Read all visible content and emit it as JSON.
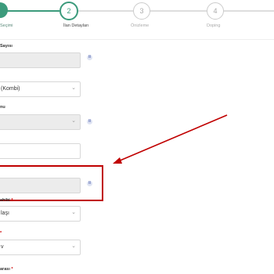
{
  "stepper": {
    "steps": [
      {
        "number": "",
        "label": "Seçimi",
        "state": "done"
      },
      {
        "number": "2",
        "label": "İlan Detayları",
        "state": "active"
      },
      {
        "number": "3",
        "label": "Önizleme",
        "state": "todo"
      },
      {
        "number": "4",
        "label": "Doping",
        "state": "todo"
      }
    ]
  },
  "form": {
    "fields": [
      {
        "label": "Sayısı",
        "required": false,
        "value": "",
        "kind": "input",
        "disabled": true,
        "info": true
      },
      {
        "label": "",
        "required": false,
        "value": "(Kombi)",
        "kind": "select",
        "disabled": false,
        "info": false
      },
      {
        "label": "nu",
        "required": false,
        "value": "",
        "kind": "select",
        "disabled": true,
        "info": true
      },
      {
        "label": "",
        "required": false,
        "value": "",
        "kind": "input",
        "disabled": false,
        "info": false
      },
      {
        "label": "",
        "required": false,
        "value": "",
        "kind": "input",
        "disabled": true,
        "info": true
      },
      {
        "label": "ahibi",
        "required": true,
        "value": "laşı",
        "kind": "select",
        "disabled": false,
        "info": false
      },
      {
        "label": "",
        "required": true,
        "value": "v",
        "kind": "select",
        "disabled": false,
        "info": false
      },
      {
        "label": "arası",
        "required": true,
        "value": "",
        "kind": "input",
        "disabled": false,
        "info": false
      }
    ],
    "required_mark": "*",
    "info_glyph": "ii",
    "chevron_glyph": "⌄"
  },
  "annotation": {
    "color": "#c00000"
  },
  "colors": {
    "accent": "#3c9b7c",
    "disabled_bg": "#ececec",
    "info_bg": "#dfe4f3"
  }
}
